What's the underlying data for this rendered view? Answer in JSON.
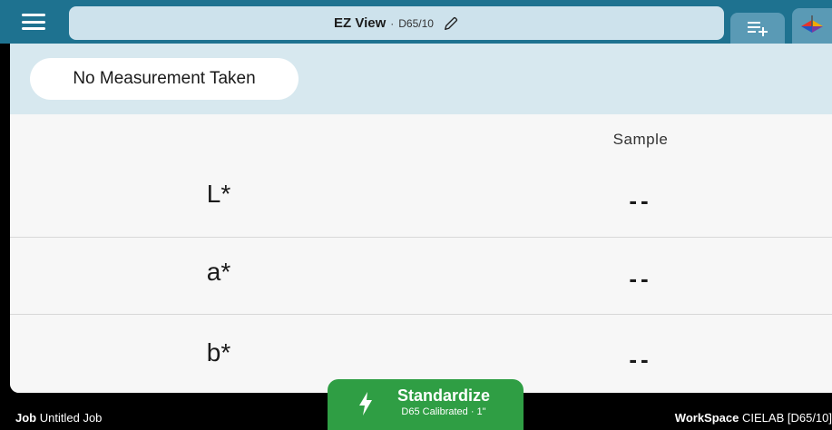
{
  "header": {
    "menu_icon": "hamburger-menu-icon",
    "title": "EZ View",
    "separator": "·",
    "subtitle": "D65/10",
    "edit_icon": "pencil-icon",
    "queue_icon": "add-to-list-icon",
    "logo_icon": "color-app-logo-icon"
  },
  "status": {
    "message": "No Measurement Taken"
  },
  "table": {
    "column_header": "Sample",
    "rows": [
      {
        "label": "L*",
        "value": "--"
      },
      {
        "label": "a*",
        "value": "--"
      },
      {
        "label": "b*",
        "value": "--"
      }
    ]
  },
  "footer": {
    "job_label": "Job",
    "job_value": "Untitled Job",
    "workspace_label": "WorkSpace",
    "workspace_value": "CIELAB [D65/10]"
  },
  "standardize": {
    "icon": "lightning-bolt-icon",
    "label": "Standardize",
    "sub": "D65 Calibrated · 1\""
  },
  "colors": {
    "header_bg": "#1e7290",
    "title_pill_bg": "#cde2ec",
    "status_strip_bg": "#d7e8ef",
    "standardize_bg": "#2f9e44"
  }
}
